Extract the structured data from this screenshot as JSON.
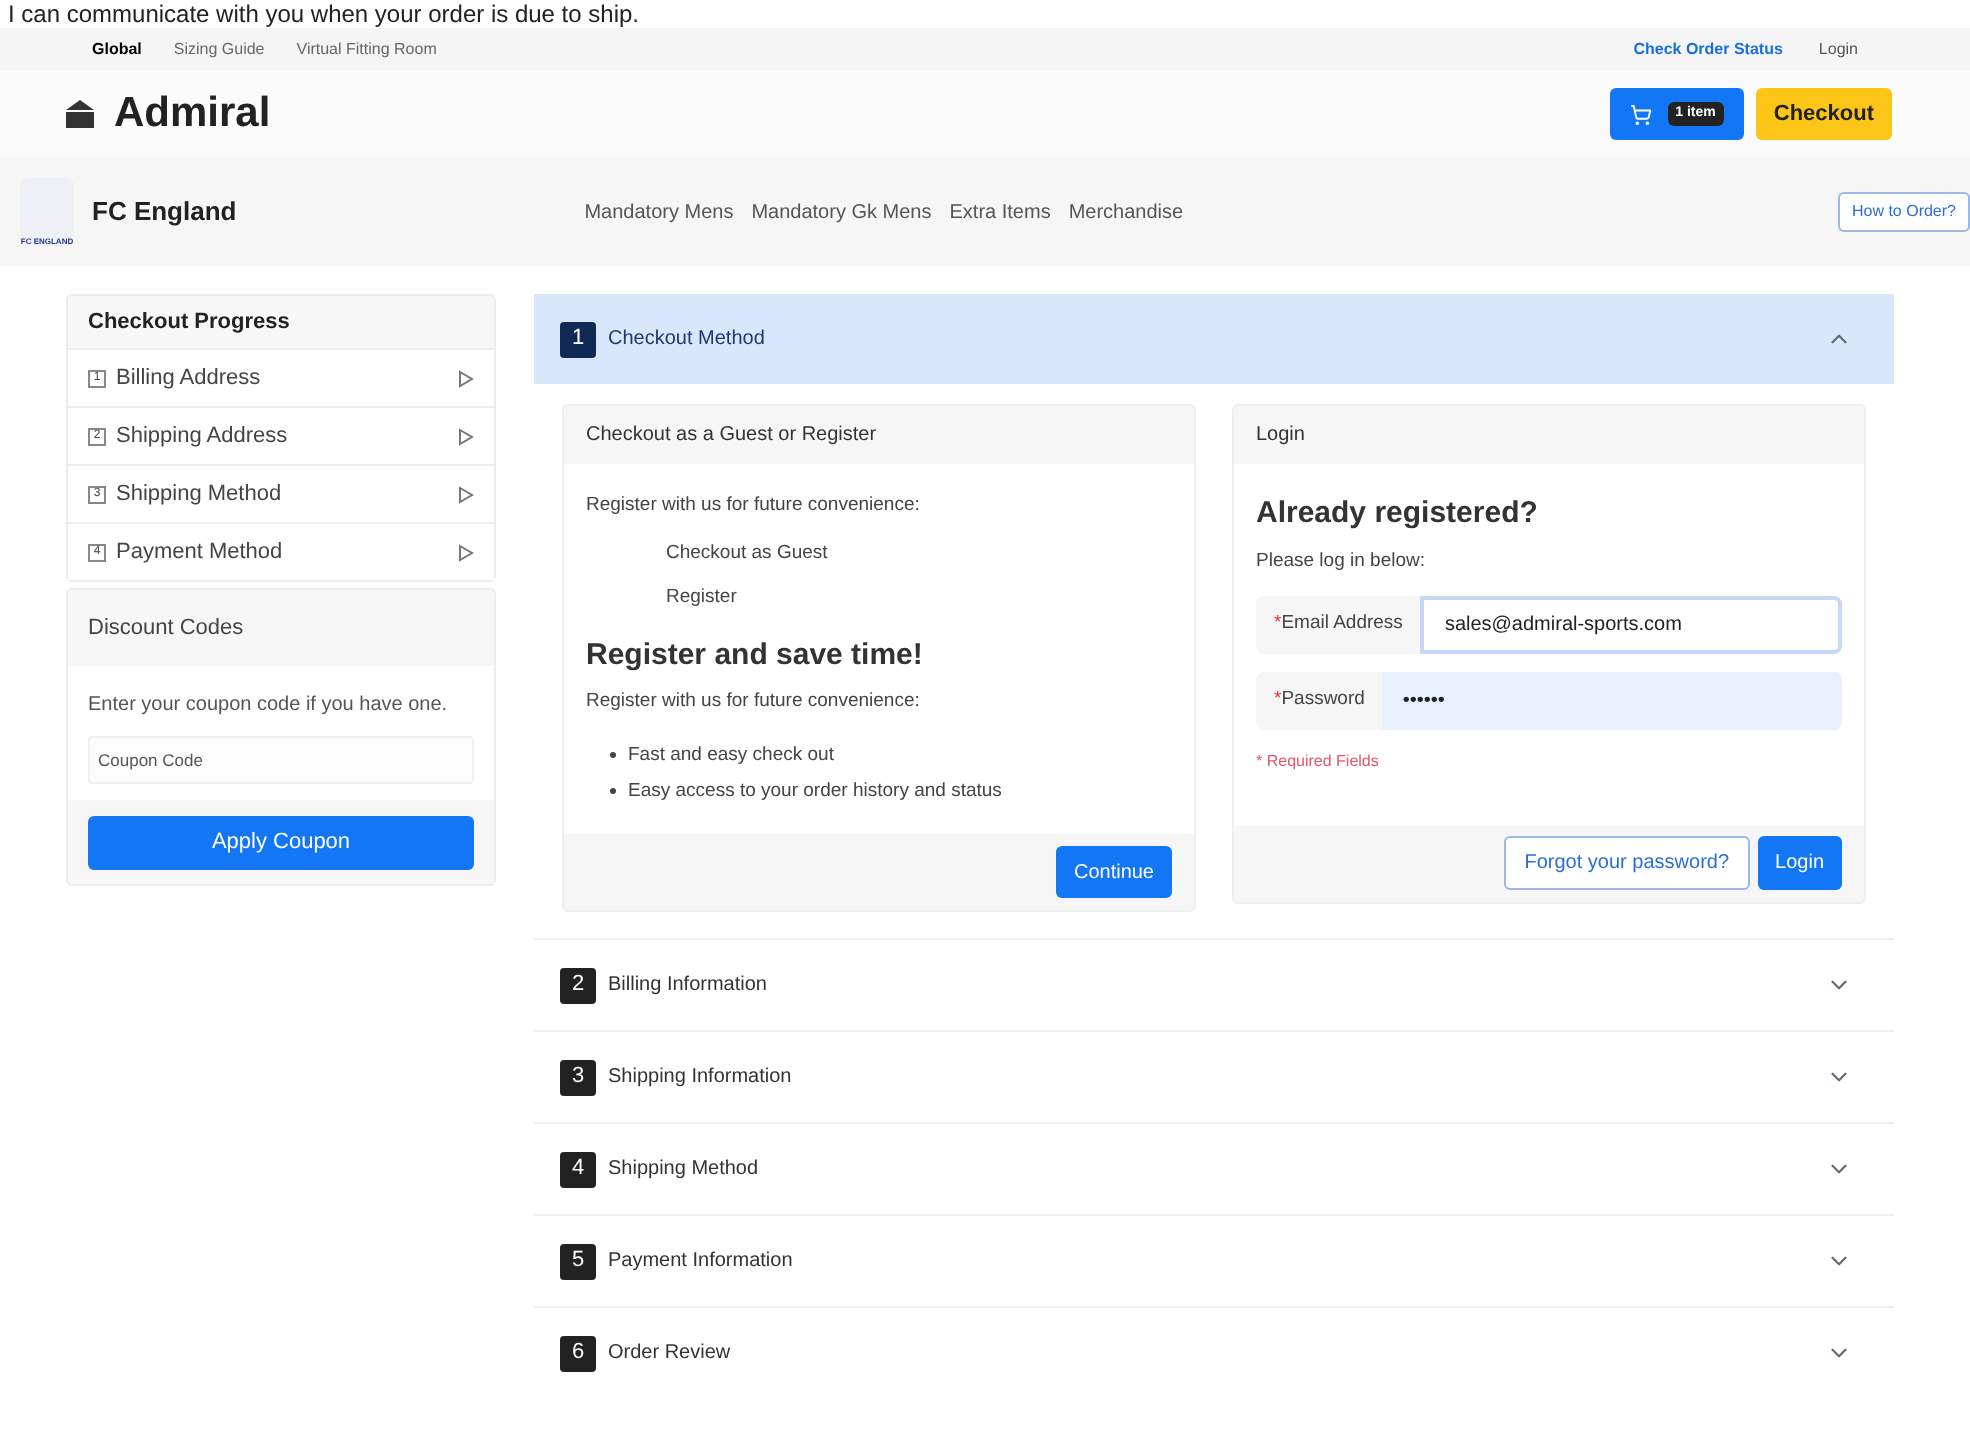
{
  "caption": "I can communicate with you when your order is due to ship.",
  "top_nav": {
    "links": [
      {
        "label": "Global",
        "selected": true
      },
      {
        "label": "Sizing Guide",
        "selected": false
      },
      {
        "label": "Virtual Fitting Room",
        "selected": false
      }
    ],
    "right_links": [
      {
        "label": "Check Order Status",
        "kind": "accent"
      },
      {
        "label": "Login",
        "kind": "plain"
      }
    ]
  },
  "header": {
    "brand": "Admiral",
    "cart_badge": "1 item",
    "checkout": "Checkout"
  },
  "team_bar": {
    "team": "FC England",
    "logo_text": "FC ENGLAND",
    "menu": [
      "Mandatory Mens",
      "Mandatory Gk Mens",
      "Extra Items",
      "Merchandise"
    ],
    "how_to_order": "How to Order?"
  },
  "sidebar": {
    "title": "Checkout Progress",
    "steps": [
      {
        "number": "1",
        "label": "Billing Address"
      },
      {
        "number": "2",
        "label": "Shipping Address"
      },
      {
        "number": "3",
        "label": "Shipping Method"
      },
      {
        "number": "4",
        "label": "Payment Method"
      }
    ],
    "discount": {
      "title": "Discount Codes",
      "text": "Enter your coupon code if you have one.",
      "placeholder": "Coupon Code",
      "button": "Apply Coupon"
    }
  },
  "sections": [
    {
      "number": "1",
      "title": "Checkout Method",
      "expanded": true
    },
    {
      "number": "2",
      "title": "Billing Information",
      "expanded": false
    },
    {
      "number": "3",
      "title": "Shipping Information",
      "expanded": false
    },
    {
      "number": "4",
      "title": "Shipping Method",
      "expanded": false
    },
    {
      "number": "5",
      "title": "Payment Information",
      "expanded": false
    },
    {
      "number": "6",
      "title": "Order Review",
      "expanded": false
    }
  ],
  "guest_panel": {
    "title": "Checkout as a Guest or Register",
    "intro": "Register with us for future convenience:",
    "options": [
      "Checkout as Guest",
      "Register"
    ],
    "heading": "Register and save time!",
    "subtext": "Register with us for future convenience:",
    "bullets": [
      "Fast and easy check out",
      "Easy access to your order history and status"
    ],
    "button": "Continue"
  },
  "login_panel": {
    "title": "Login",
    "heading": "Already registered?",
    "subtext": "Please log in below:",
    "required_mark": "*",
    "fields": [
      {
        "label": "Email Address",
        "value": "sales@admiral-sports.com",
        "focused": true
      },
      {
        "label": "Password",
        "value": "••••••",
        "focused": false
      }
    ],
    "required_note": "* Required Fields",
    "forgot": "Forgot your password?",
    "button": "Login"
  }
}
